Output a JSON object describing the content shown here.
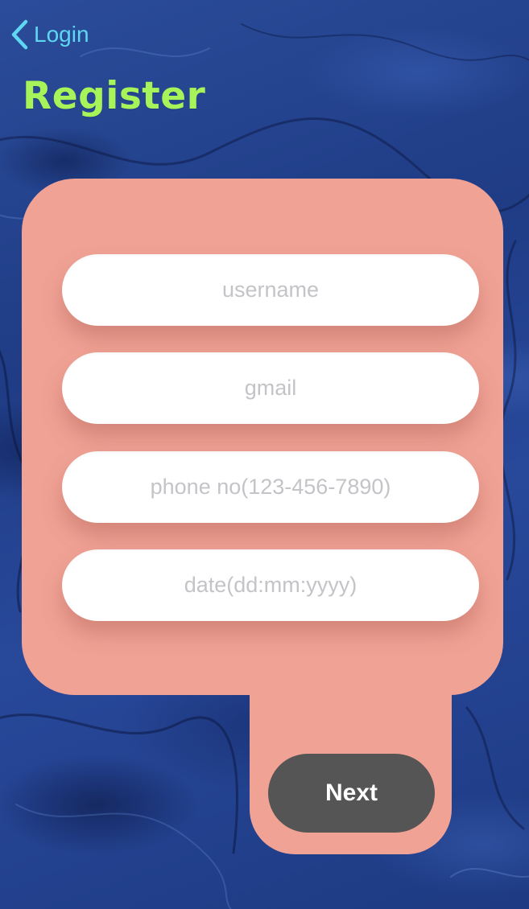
{
  "nav": {
    "back_label": "Login",
    "back_icon": "chevron-left-icon",
    "accent_color": "#5fd7f0"
  },
  "header": {
    "title": "Register",
    "title_color": "#a6f35a"
  },
  "form": {
    "card_color": "#f0a295",
    "fields": [
      {
        "name": "username",
        "value": "",
        "placeholder": "username"
      },
      {
        "name": "gmail",
        "value": "",
        "placeholder": "gmail"
      },
      {
        "name": "phone",
        "value": "",
        "placeholder": "phone no(123-456-7890)"
      },
      {
        "name": "date",
        "value": "",
        "placeholder": "date(dd:mm:yyyy)"
      }
    ],
    "next_label": "Next",
    "next_color": "#555555"
  }
}
